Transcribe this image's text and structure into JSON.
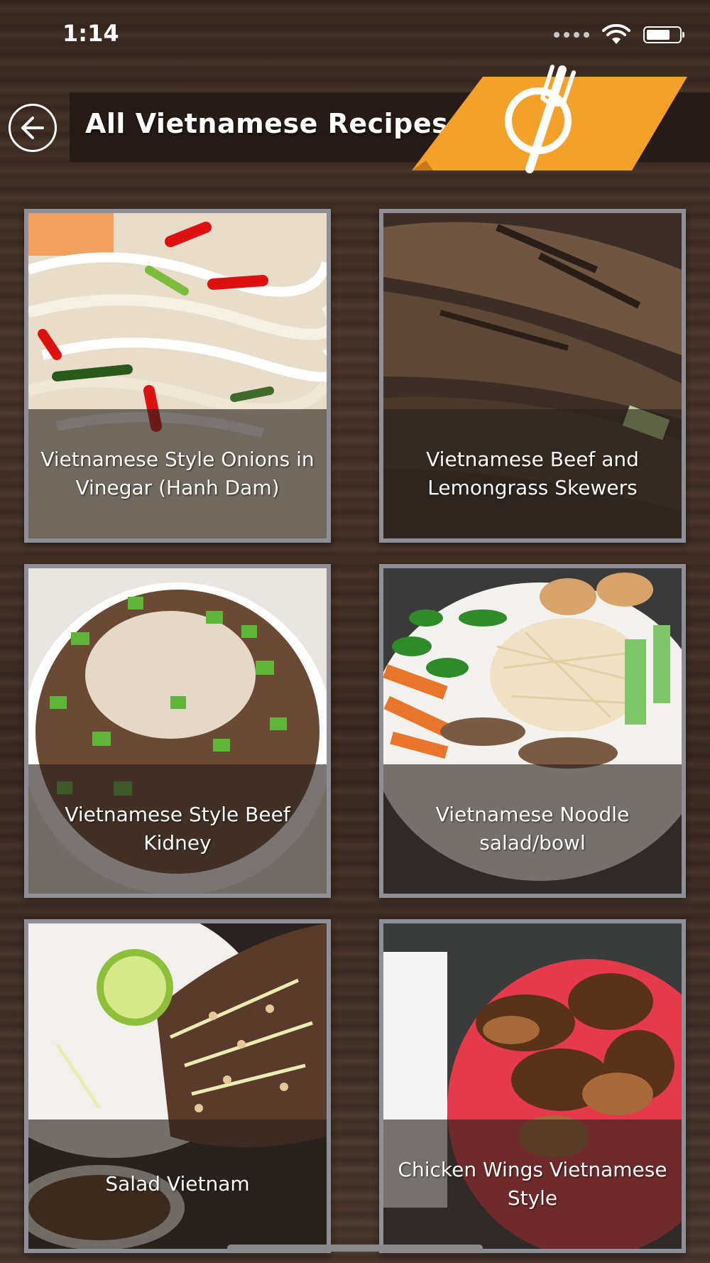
{
  "status_bar": {
    "time": "1:14"
  },
  "header": {
    "title": "All Vietnamese Recipes",
    "back_icon": "arrow-left-circle-icon",
    "logo_icon": "fork-knife-plate-logo",
    "accent_color": "#f4a12a"
  },
  "recipes": [
    {
      "title": "Vietnamese Style Onions in Vinegar (Hanh Dam)"
    },
    {
      "title": "Vietnamese Beef and Lemongrass Skewers"
    },
    {
      "title": "Vietnamese Style Beef Kidney"
    },
    {
      "title": "Vietnamese Noodle salad/bowl"
    },
    {
      "title": "Salad Vietnam"
    },
    {
      "title": "Chicken Wings Vietnamese Style"
    }
  ]
}
